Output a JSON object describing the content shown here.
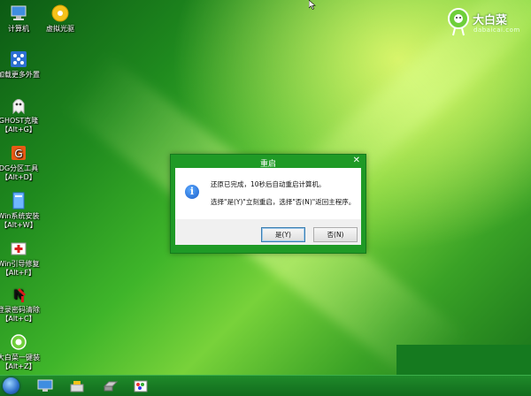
{
  "desktop": {
    "icons": [
      {
        "label1": "计算机",
        "label2": ""
      },
      {
        "label1": "虚拟光驱",
        "label2": ""
      },
      {
        "label1": "加载更多外置",
        "label2": ""
      },
      {
        "label1": "GHOST克隆",
        "label2": "【Alt+G】"
      },
      {
        "label1": "DG分区工具",
        "label2": "【Alt+D】"
      },
      {
        "label1": "Win系统安装",
        "label2": "【Alt+W】"
      },
      {
        "label1": "Win引导修复",
        "label2": "【Alt+F】"
      },
      {
        "label1": "登录密码清除",
        "label2": "【Alt+C】"
      },
      {
        "label1": "大白菜一键装",
        "label2": "【Alt+Z】"
      }
    ]
  },
  "brand": {
    "name": "大白菜",
    "domain": "dabaicai.com"
  },
  "dialog": {
    "title": "重启",
    "close_glyph": "✕",
    "message_line1": "还原已完成，10秒后自动重启计算机。",
    "message_line2": "选择\"是(Y)\"立刻重启，选择\"否(N)\"返回主程序。",
    "yes_label": "是(Y)",
    "no_label": "否(N)",
    "info_glyph": "i"
  },
  "colors": {
    "dialog_frame": "#1f9a26",
    "taskbar": "#126c1d",
    "accent_blue": "#1c5fc9"
  }
}
